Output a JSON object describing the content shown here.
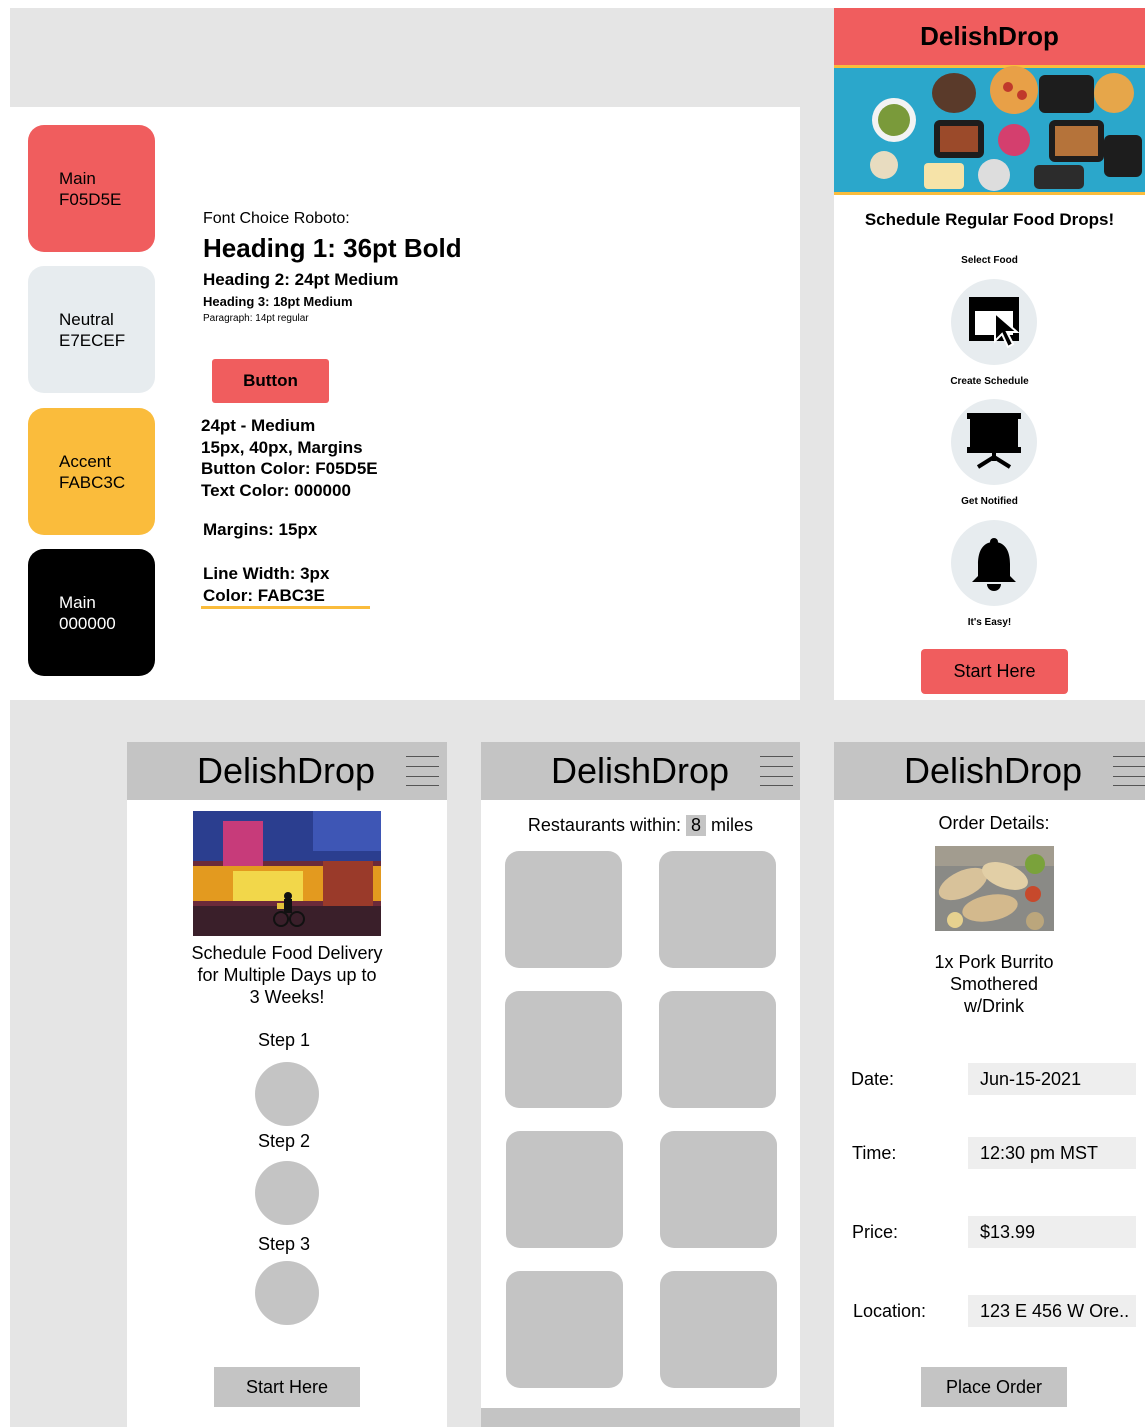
{
  "colors": {
    "main": "#F05D5E",
    "neutral": "#E7ECEF",
    "accent": "#FABC3C",
    "black": "#000000",
    "wireframe_gray": "#C4C4C4",
    "canvas_gray": "#E5E5E5"
  },
  "style_guide": {
    "swatches": [
      {
        "name": "Main",
        "code": "F05D5E",
        "color": "#F05D5E",
        "text_color": "#000000"
      },
      {
        "name": "Neutral",
        "code": "E7ECEF",
        "color": "#E7ECEF",
        "text_color": "#000000"
      },
      {
        "name": "Accent",
        "code": "FABC3C",
        "color": "#FABC3C",
        "text_color": "#000000"
      },
      {
        "name": "Main",
        "code": "000000",
        "color": "#000000",
        "text_color": "#FFFFFF"
      }
    ],
    "font_choice": "Font Choice Roboto:",
    "heading1": "Heading 1: 36pt Bold",
    "heading2": "Heading 2: 24pt Medium",
    "heading3": "Heading 3: 18pt Medium",
    "paragraph": "Paragraph: 14pt regular",
    "button_label": "Button",
    "button_specs": [
      "24pt - Medium",
      "15px, 40px, Margins",
      "Button Color: F05D5E",
      "Text Color: 000000"
    ],
    "margins": "Margins: 15px",
    "line_specs": [
      "Line Width: 3px",
      "Color: FABC3E"
    ]
  },
  "hifi_screen": {
    "brand": "DelishDrop",
    "tagline": "Schedule Regular Food Drops!",
    "steps": [
      {
        "label": "Select Food",
        "icon": "cursor-window-icon"
      },
      {
        "label": "Create Schedule",
        "icon": "presentation-board-icon"
      },
      {
        "label": "Get Notified",
        "icon": "bell-icon"
      }
    ],
    "footer_note": "It's Easy!",
    "cta": "Start Here"
  },
  "wire_home": {
    "brand": "DelishDrop",
    "description": [
      "Schedule Food Delivery",
      "for Multiple Days up to",
      "3 Weeks!"
    ],
    "steps": [
      "Step 1",
      "Step 2",
      "Step 3"
    ],
    "cta": "Start Here"
  },
  "wire_restaurants": {
    "brand": "DelishDrop",
    "filter_prefix": "Restaurants within:",
    "filter_value": "8",
    "filter_suffix": "miles"
  },
  "wire_order": {
    "brand": "DelishDrop",
    "title": "Order Details:",
    "item": [
      "1x Pork Burrito",
      "Smothered",
      "w/Drink"
    ],
    "fields": [
      {
        "label": "Date:",
        "value": "Jun-15-2021"
      },
      {
        "label": "Time:",
        "value": "12:30 pm MST"
      },
      {
        "label": "Price:",
        "value": "$13.99"
      },
      {
        "label": "Location:",
        "value": "123 E 456 W Ore.."
      }
    ],
    "cta": "Place Order"
  }
}
